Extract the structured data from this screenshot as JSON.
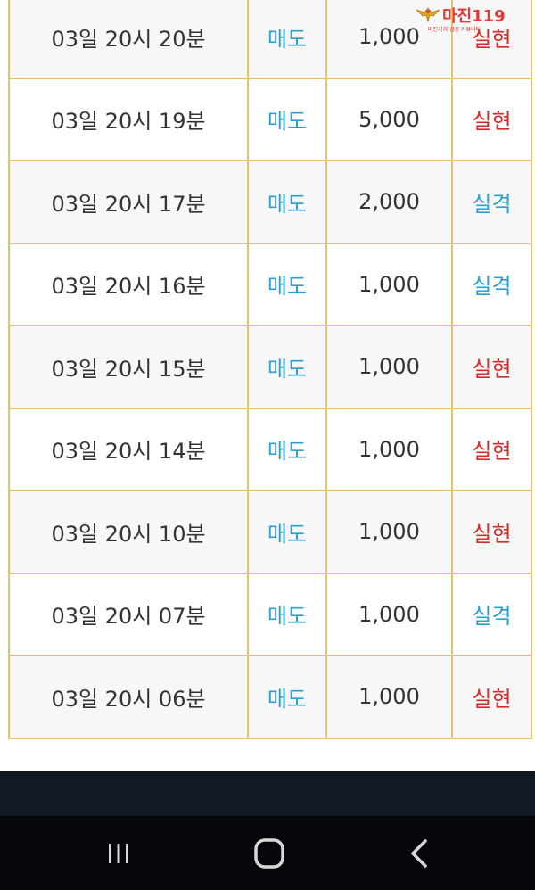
{
  "logo": {
    "brand": "마진119",
    "tagline": "마진거래 검증 커뮤니티"
  },
  "rows": [
    {
      "time": "03일 20시 20분",
      "type": "매도",
      "amount": "1,000",
      "result": "실현",
      "result_kind": "hit"
    },
    {
      "time": "03일 20시 19분",
      "type": "매도",
      "amount": "5,000",
      "result": "실현",
      "result_kind": "hit"
    },
    {
      "time": "03일 20시 17분",
      "type": "매도",
      "amount": "2,000",
      "result": "실격",
      "result_kind": "miss"
    },
    {
      "time": "03일 20시 16분",
      "type": "매도",
      "amount": "1,000",
      "result": "실격",
      "result_kind": "miss"
    },
    {
      "time": "03일 20시 15분",
      "type": "매도",
      "amount": "1,000",
      "result": "실현",
      "result_kind": "hit"
    },
    {
      "time": "03일 20시 14분",
      "type": "매도",
      "amount": "1,000",
      "result": "실현",
      "result_kind": "hit"
    },
    {
      "time": "03일 20시 10분",
      "type": "매도",
      "amount": "1,000",
      "result": "실현",
      "result_kind": "hit"
    },
    {
      "time": "03일 20시 07분",
      "type": "매도",
      "amount": "1,000",
      "result": "실격",
      "result_kind": "miss"
    },
    {
      "time": "03일 20시 06분",
      "type": "매도",
      "amount": "1,000",
      "result": "실현",
      "result_kind": "hit"
    }
  ],
  "colors": {
    "border": "#e3c46a",
    "sell": "#2aa0cf",
    "hit": "#d52b2b",
    "miss": "#2aa0cf",
    "navbar": "#05070b"
  },
  "navbar": {
    "recents_icon": "recents-icon",
    "home_icon": "home-icon",
    "back_icon": "back-icon"
  }
}
